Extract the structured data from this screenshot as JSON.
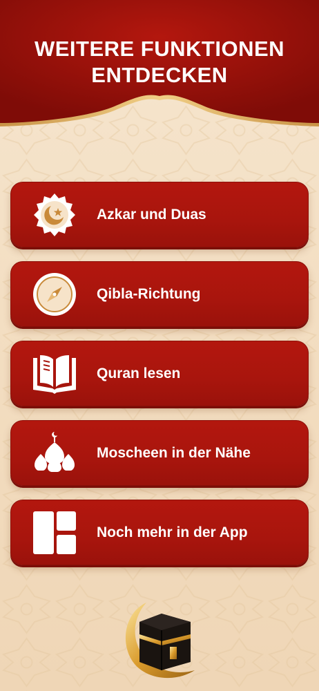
{
  "header": {
    "title_line1": "WEITERE FUNKTIONEN",
    "title_line2": "ENTDECKEN"
  },
  "menu": {
    "items": [
      {
        "label": "Azkar und Duas",
        "icon": "star-crescent-icon"
      },
      {
        "label": "Qibla-Richtung",
        "icon": "compass-icon"
      },
      {
        "label": "Quran lesen",
        "icon": "open-book-icon"
      },
      {
        "label": "Moscheen in der Nähe",
        "icon": "mosque-icon"
      },
      {
        "label": "Noch mehr in der App",
        "icon": "app-grid-icon"
      }
    ]
  },
  "colors": {
    "brand_red": "#a8150d",
    "header_red": "#8e0f0a",
    "background_cream": "#f3dec2",
    "gold": "#d8a24a"
  },
  "decoration": {
    "bottom_icon": "kaaba-crescent-icon"
  }
}
